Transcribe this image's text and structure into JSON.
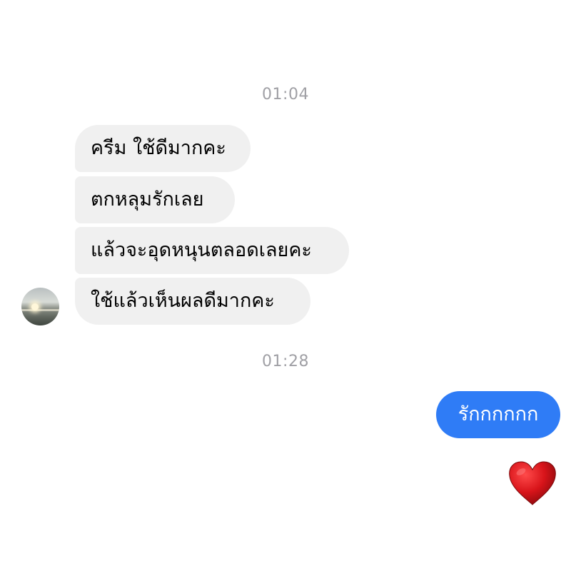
{
  "timestamps": {
    "first": "01:04",
    "second": "01:28"
  },
  "incoming_messages": [
    "ครีม ใช้ดีมากคะ",
    "ตกหลุมรักเลย",
    "แล้วจะอุดหนุนตลอดเลยคะ",
    "ใช้แล้วเห็นผลดีมากคะ"
  ],
  "outgoing_messages": [
    "รักกกกกก"
  ],
  "reaction": {
    "icon": "heart-icon",
    "color": "#d0141a"
  },
  "colors": {
    "incoming_bubble": "#f0f0f0",
    "outgoing_bubble": "#2f7cf6",
    "timestamp_text": "#a0a0a5"
  }
}
